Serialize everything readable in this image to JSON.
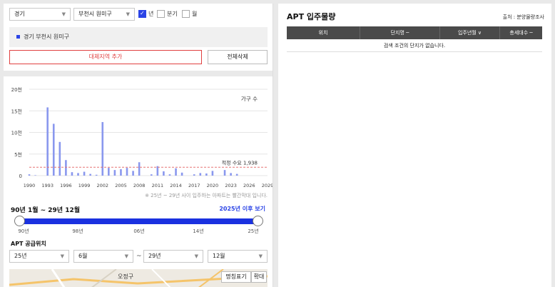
{
  "filters": {
    "province": "경기",
    "district": "부천시 원미구",
    "period_options": [
      {
        "label": "년",
        "checked": true
      },
      {
        "label": "분기",
        "checked": false
      },
      {
        "label": "월",
        "checked": false
      }
    ]
  },
  "region_item": "경기 부천시 원미구",
  "buttons": {
    "add_compare": "대체지역 추가",
    "delete_all": "전체삭제"
  },
  "chart_data": {
    "type": "bar",
    "legend_label": "가구 수",
    "y_ticks": [
      "20천",
      "15천",
      "10천",
      "5천",
      "0"
    ],
    "ylim": [
      0,
      20000
    ],
    "x_ticks": [
      "1990",
      "1993",
      "1996",
      "1999",
      "2002",
      "2005",
      "2008",
      "2011",
      "2014",
      "2017",
      "2020",
      "2023",
      "2026",
      "2029"
    ],
    "x": [
      1990,
      1991,
      1992,
      1993,
      1994,
      1995,
      1996,
      1997,
      1998,
      1999,
      2000,
      2001,
      2002,
      2003,
      2004,
      2005,
      2006,
      2007,
      2008,
      2009,
      2010,
      2011,
      2012,
      2013,
      2014,
      2015,
      2016,
      2017,
      2018,
      2019,
      2020,
      2021,
      2022,
      2023,
      2024,
      2025
    ],
    "values": [
      300,
      100,
      0,
      15800,
      12000,
      7800,
      3600,
      800,
      600,
      900,
      400,
      200,
      12400,
      1800,
      1300,
      1500,
      1800,
      1100,
      3100,
      0,
      300,
      2200,
      1000,
      300,
      1700,
      700,
      0,
      300,
      600,
      500,
      1100,
      0,
      1300,
      600,
      400,
      0
    ],
    "reference_line": {
      "label": "적정 수요",
      "value_text": "1,938",
      "value": 1938
    },
    "note": "※ 25년 ~ 29년 사이 입주하는 아파트는 빨간막대 입니다."
  },
  "period": {
    "label": "90년 1월 ~ 29년 12월",
    "after_link": "2025년 이후 보기",
    "range_start": 0,
    "range_end": 1,
    "ticks": [
      "90년",
      "98년",
      "06년",
      "14년",
      "25년"
    ]
  },
  "supply": {
    "title": "APT 공급위치",
    "from_year": "25년",
    "from_month": "6월",
    "tilde": "~",
    "to_year": "29년",
    "to_month": "12월"
  },
  "map": {
    "place_label": "오정구",
    "toggle_label": "명칭표기",
    "zoom_label": "확대"
  },
  "right_panel": {
    "title": "APT 입주물량",
    "source": "출처 : 분양물량조사",
    "columns": [
      "위치",
      "단지명 ─",
      "입주년월 ∨",
      "총세대수 ─"
    ],
    "empty_message": "검색 조건의 단지가 없습니다."
  },
  "colors": {
    "accent": "#2b44e6",
    "bar": "#8a98ee",
    "danger": "#e04040",
    "reference": "#e57373"
  }
}
